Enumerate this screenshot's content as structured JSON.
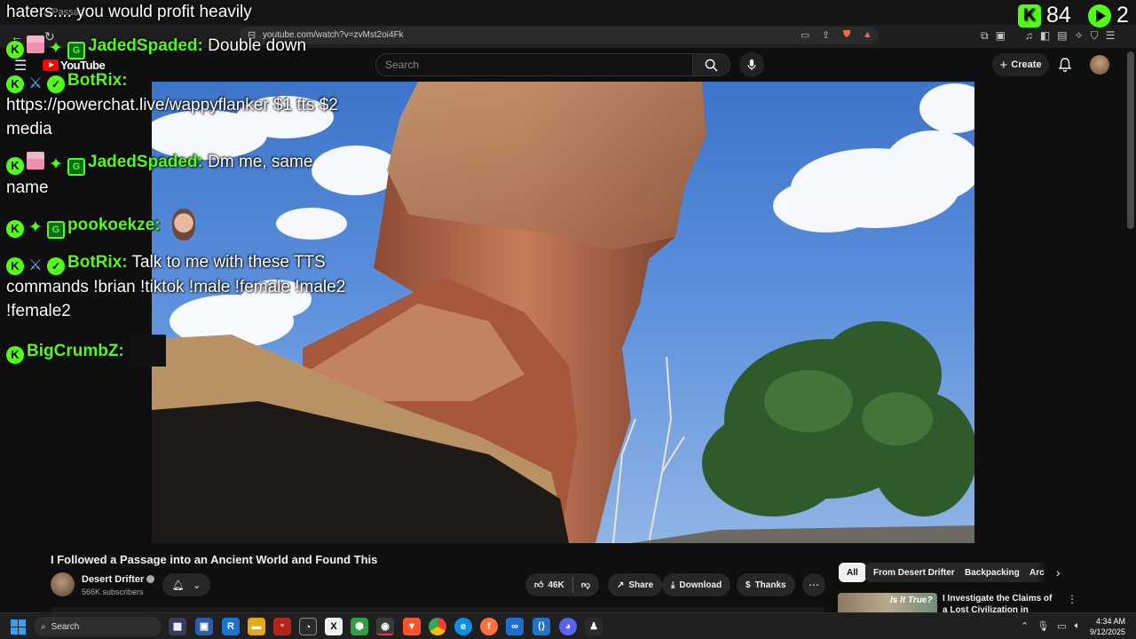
{
  "browser": {
    "tab_title": "...a Passag...",
    "url": "youtube.com/watch?v=zvMst2oi4Fk",
    "back_icon": "arrow-left-icon",
    "reload_icon": "reload-icon"
  },
  "youtube": {
    "logo_text": "YouTube",
    "search_placeholder": "Search",
    "create_label": "Create"
  },
  "overlay": {
    "top_text": "haters.... you would profit heavily",
    "viewer_count": "84",
    "follower_count": "2",
    "colors": {
      "kick_green": "#53fc18",
      "sword_blue": "#56b0ff"
    }
  },
  "chat": {
    "messages": [
      {
        "username": "JadedSpaded:",
        "text": "Double down",
        "badges": [
          "kick-icon",
          "gift-icon",
          "sparkle-icon",
          "subscriber-icon"
        ]
      },
      {
        "username": "BotRix:",
        "text": "https://powerchat.live/wappyflanker $1 tts $2 media",
        "badges": [
          "kick-icon",
          "sword-icon",
          "verified-icon"
        ]
      },
      {
        "username": "JadedSpaded:",
        "text": "Dm me, same name",
        "badges": [
          "kick-icon",
          "gift-icon",
          "sparkle-icon",
          "subscriber-icon"
        ]
      },
      {
        "username": "pookoekze:",
        "text": "",
        "badges": [
          "kick-icon",
          "sparkle-icon",
          "subscriber-icon"
        ]
      },
      {
        "username": "BotRix:",
        "text": "Talk to me with these TTS commands !brian !tiktok !male !female !male2 !female2",
        "badges": [
          "kick-icon",
          "sword-icon",
          "verified-icon"
        ]
      },
      {
        "username": "BigCrumbZ:",
        "text": "",
        "badges": [
          "kick-icon"
        ]
      }
    ]
  },
  "video": {
    "title": "I Followed a Passage into an Ancient World and Found This",
    "channel_name": "Desert Drifter",
    "subscribers": "566K subscribers",
    "likes": "46K",
    "share_label": "Share",
    "download_label": "Download",
    "thanks_label": "Thanks"
  },
  "sidebar": {
    "chips": [
      "All",
      "From Desert Drifter",
      "Backpacking",
      "Arc"
    ],
    "recommendation": {
      "thumb_label": "Is It True?",
      "title": "I Investigate the Claims of a Lost Civilization in Montana"
    }
  },
  "taskbar": {
    "search_label": "Search",
    "time": "4:34 AM",
    "date": "9/12/2025"
  }
}
